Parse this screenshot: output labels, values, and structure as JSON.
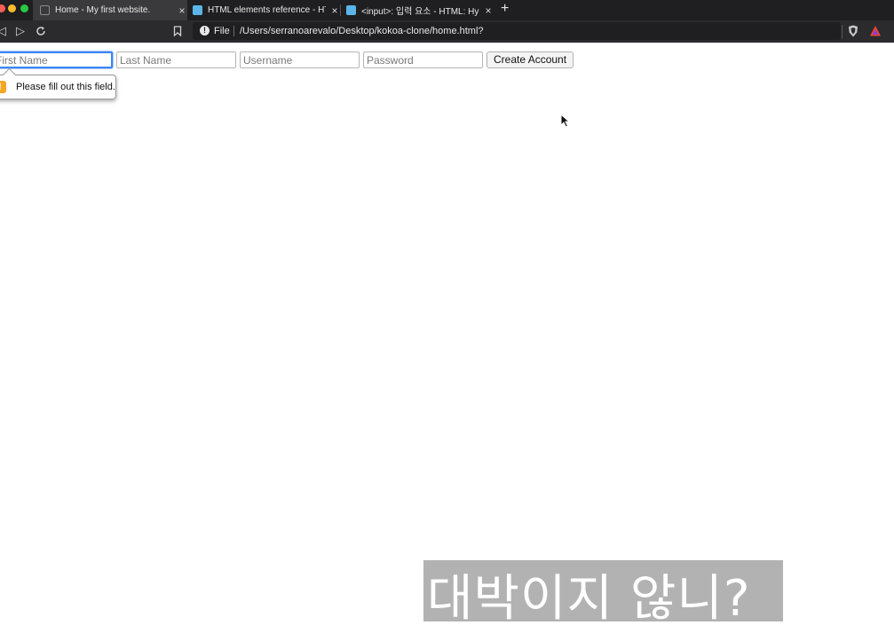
{
  "browser": {
    "tabs": [
      {
        "title": "Home - My first website.",
        "favicon": "globe-icon",
        "active": true
      },
      {
        "title": "HTML elements reference - HTM",
        "favicon": "mdn-icon",
        "active": false
      },
      {
        "title": "<input>: 입력 요소 - HTML: Hypert",
        "favicon": "mdn-icon",
        "active": false
      }
    ],
    "close_glyph": "×",
    "new_tab_glyph": "+",
    "address": {
      "scheme_label": "File",
      "url": "/Users/serranoarevalo/Desktop/kokoa-clone/home.html?"
    }
  },
  "form": {
    "first_name_placeholder": "First Name",
    "last_name_placeholder": "Last Name",
    "username_placeholder": "Username",
    "password_placeholder": "Password",
    "submit_label": "Create Account"
  },
  "validation": {
    "message": "Please fill out this field.",
    "icon": "warning-icon",
    "icon_glyph": "!"
  },
  "caption": {
    "text": "대박이지 않니?"
  },
  "colors": {
    "focus_ring": "#3b86f6",
    "warning": "#f5a623",
    "tabbar_bg": "#1f1f21"
  }
}
